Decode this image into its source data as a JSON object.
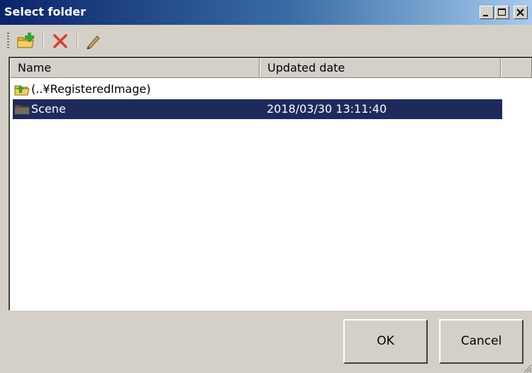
{
  "window": {
    "title": "Select folder",
    "controls": {
      "minimize_icon": "minimize-icon",
      "maximize_icon": "maximize-icon",
      "close_icon": "close-icon"
    }
  },
  "toolbar": {
    "tools": [
      {
        "name": "new-folder",
        "icon": "new-folder-icon"
      },
      {
        "name": "delete",
        "icon": "delete-x-icon"
      },
      {
        "name": "rename",
        "icon": "pencil-icon"
      }
    ]
  },
  "list": {
    "columns": [
      "Name",
      "Updated date"
    ],
    "rows": [
      {
        "name": "(..¥RegisteredImage)",
        "date": "",
        "icon": "parent-folder-icon",
        "selected": false
      },
      {
        "name": "Scene",
        "date": "2018/03/30 13:11:40",
        "icon": "folder-icon",
        "selected": true
      }
    ]
  },
  "buttons": {
    "ok": "OK",
    "cancel": "Cancel"
  },
  "colors": {
    "title_bar_start": "#0a246a",
    "selection": "#1f2a5c",
    "dialog_bg": "#d4d0c8"
  }
}
